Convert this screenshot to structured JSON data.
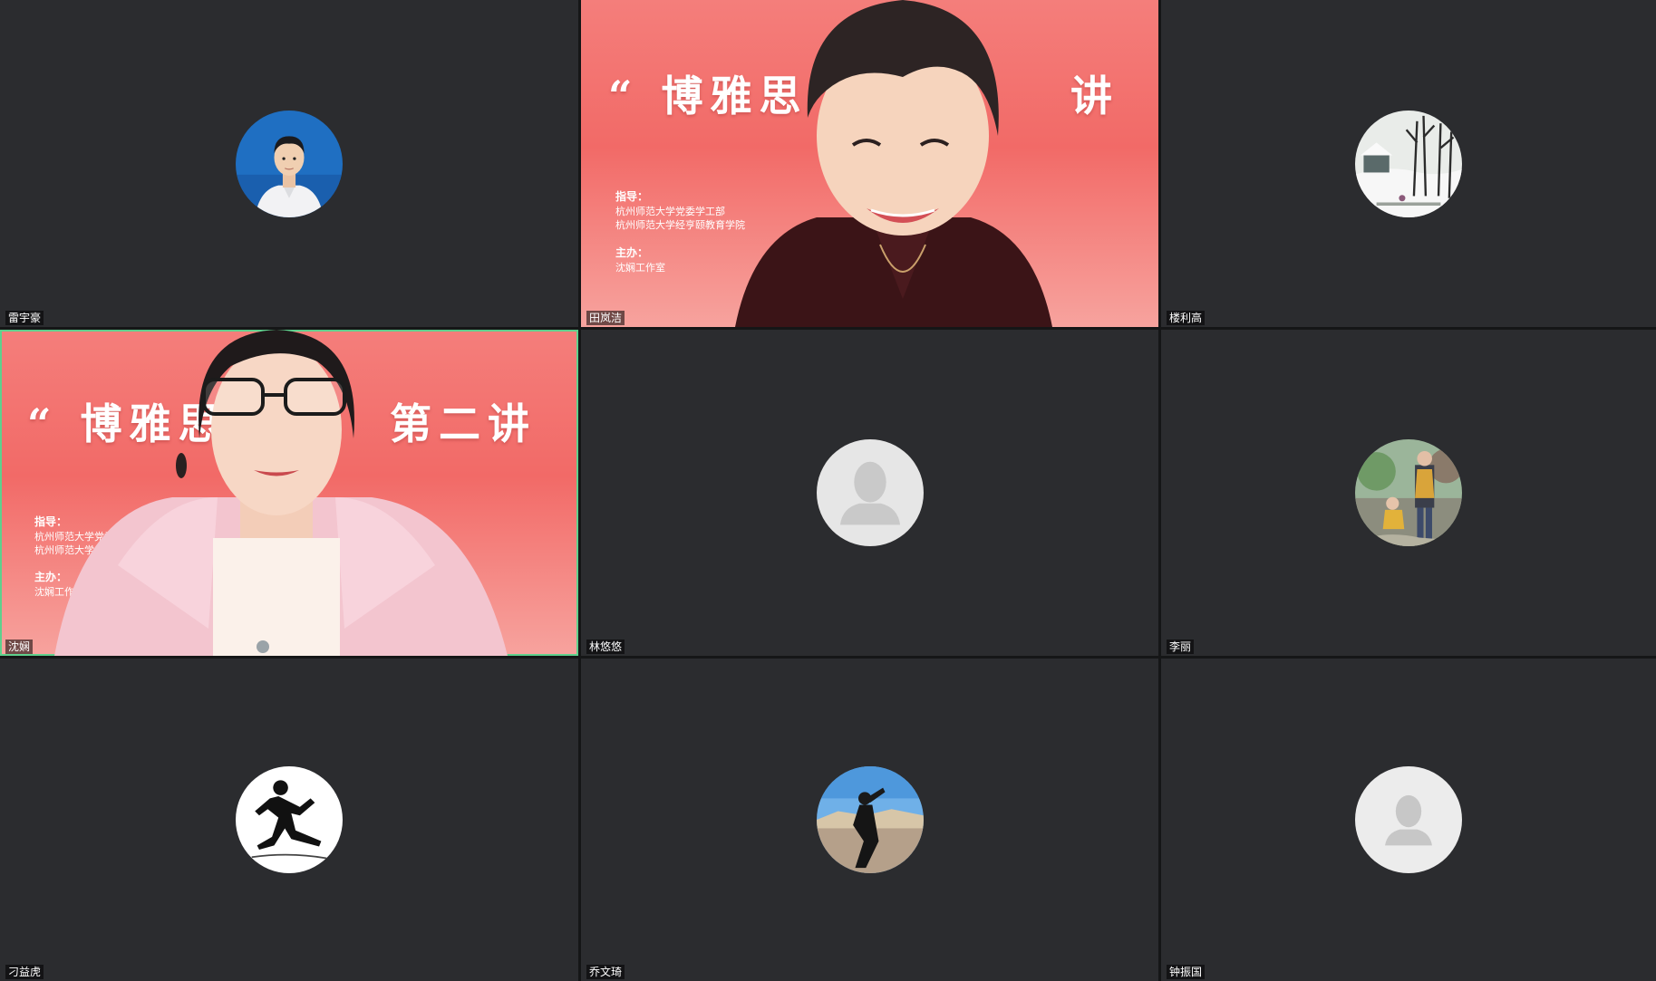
{
  "participants": [
    {
      "name": "雷宇豪",
      "type": "avatar",
      "avatar_icon": "profile-photo-icon"
    },
    {
      "name": "田岚洁",
      "type": "video"
    },
    {
      "name": "楼利高",
      "type": "avatar",
      "avatar_icon": "winter-scene-icon"
    },
    {
      "name": "沈娴",
      "type": "video",
      "active_speaker": true
    },
    {
      "name": "林悠悠",
      "type": "avatar",
      "avatar_icon": "default-user-icon"
    },
    {
      "name": "李丽",
      "type": "avatar",
      "avatar_icon": "family-photo-icon"
    },
    {
      "name": "刁益虎",
      "type": "avatar",
      "avatar_icon": "runner-sketch-icon"
    },
    {
      "name": "乔文琦",
      "type": "avatar",
      "avatar_icon": "desert-photo-icon"
    },
    {
      "name": "钟振国",
      "type": "avatar",
      "avatar_icon": "default-user-icon"
    }
  ],
  "banner_a": {
    "title_left": "“ 博雅思",
    "title_right": "讲",
    "guide_label": "指导：",
    "guide_line1": "杭州师范大学党委学工部",
    "guide_line2": "杭州师范大学经亨颐教育学院",
    "host_label": "主办：",
    "host_line": "沈娴工作室"
  },
  "banner_b": {
    "title_left": "“ 博雅思",
    "title_right": "第二讲",
    "guide_label": "指导：",
    "guide_line1": "杭州师范大学党委学工部",
    "guide_line2": "杭州师范大学经",
    "host_label": "主办：",
    "host_line": "沈娴工作"
  },
  "colors": {
    "tile_bg": "#2b2c2f",
    "active_border": "#5fd08d",
    "banner_red": "#f26a67"
  }
}
